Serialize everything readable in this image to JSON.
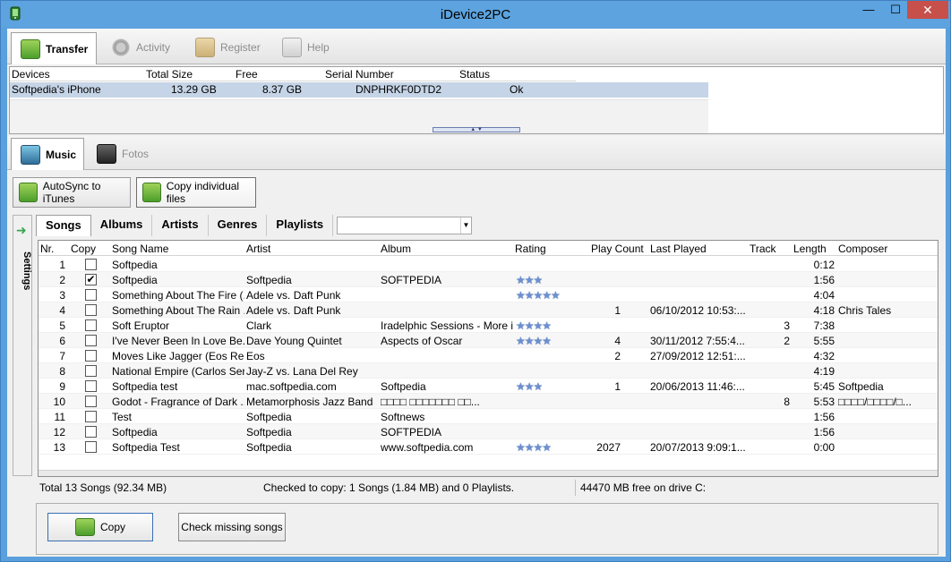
{
  "window": {
    "title": "iDevice2PC",
    "min": "—",
    "max": "☐",
    "close": "✕"
  },
  "toptabs": [
    {
      "label": "Transfer",
      "icon": "transfer-icon"
    },
    {
      "label": "Activity",
      "icon": "gear-icon"
    },
    {
      "label": "Register",
      "icon": "lock-icon"
    },
    {
      "label": "Help",
      "icon": "help-icon"
    }
  ],
  "devices": {
    "headers": [
      "Devices",
      "Total Size",
      "Free",
      "Serial Number",
      "Status"
    ],
    "row": [
      "Softpedia's iPhone",
      "13.29 GB",
      "8.37 GB",
      "DNPHRKF0DTD2",
      "Ok"
    ]
  },
  "subtabs": [
    {
      "label": "Music",
      "icon": "music-icon"
    },
    {
      "label": "Fotos",
      "icon": "camera-icon"
    }
  ],
  "mode": {
    "autosync": "AutoSync to iTunes",
    "copy_individual": "Copy individual files"
  },
  "settings_label": "Settings",
  "filters": [
    "Songs",
    "Albums",
    "Artists",
    "Genres",
    "Playlists"
  ],
  "columns": [
    "Nr.",
    "Copy",
    "Song Name",
    "Artist",
    "Album",
    "Rating",
    "Play Count",
    "Last Played",
    "Track",
    "Length",
    "Composer"
  ],
  "songs": [
    {
      "nr": "1",
      "checked": false,
      "name": "Softpedia",
      "artist": "",
      "album": "",
      "rating": 0,
      "plays": "",
      "last": "",
      "track": "",
      "length": "0:12",
      "composer": ""
    },
    {
      "nr": "2",
      "checked": true,
      "name": "Softpedia",
      "artist": "Softpedia",
      "album": "SOFTPEDIA",
      "rating": 3,
      "plays": "",
      "last": "",
      "track": "",
      "length": "1:56",
      "composer": ""
    },
    {
      "nr": "3",
      "checked": false,
      "name": "Something About The Fire (...",
      "artist": "Adele vs. Daft Punk",
      "album": "",
      "rating": 5,
      "plays": "",
      "last": "",
      "track": "",
      "length": "4:04",
      "composer": ""
    },
    {
      "nr": "4",
      "checked": false,
      "name": "Something About The Rain ...",
      "artist": "Adele vs. Daft Punk",
      "album": "",
      "rating": 0,
      "plays": "1",
      "last": "06/10/2012 10:53:...",
      "track": "",
      "length": "4:18",
      "composer": "Chris Tales"
    },
    {
      "nr": "5",
      "checked": false,
      "name": "Soft Eruptor",
      "artist": "Clark",
      "album": "Iradelphic Sessions - More i...",
      "rating": 4,
      "plays": "",
      "last": "",
      "track": "3",
      "length": "7:38",
      "composer": ""
    },
    {
      "nr": "6",
      "checked": false,
      "name": "I've Never Been In Love Be...",
      "artist": "Dave Young Quintet",
      "album": "Aspects of Oscar",
      "rating": 4,
      "plays": "4",
      "last": "30/11/2012 7:55:4...",
      "track": "2",
      "length": "5:55",
      "composer": ""
    },
    {
      "nr": "7",
      "checked": false,
      "name": "Moves Like Jagger (Eos Re...",
      "artist": "Eos",
      "album": "",
      "rating": 0,
      "plays": "2",
      "last": "27/09/2012 12:51:...",
      "track": "",
      "length": "4:32",
      "composer": ""
    },
    {
      "nr": "8",
      "checked": false,
      "name": "National Empire (Carlos Ser...",
      "artist": "Jay-Z vs. Lana Del Rey",
      "album": "",
      "rating": 0,
      "plays": "",
      "last": "",
      "track": "",
      "length": "4:19",
      "composer": ""
    },
    {
      "nr": "9",
      "checked": false,
      "name": "Softpedia test",
      "artist": "mac.softpedia.com",
      "album": "Softpedia",
      "rating": 3,
      "plays": "1",
      "last": "20/06/2013 11:46:...",
      "track": "",
      "length": "5:45",
      "composer": "Softpedia"
    },
    {
      "nr": "10",
      "checked": false,
      "name": "Godot - Fragrance of Dark ...",
      "artist": "Metamorphosis Jazz Band",
      "album": "□□□□ □□□□□□□ □□...",
      "rating": 0,
      "plays": "",
      "last": "",
      "track": "8",
      "length": "5:53",
      "composer": "□□□□/□□□□/□..."
    },
    {
      "nr": "11",
      "checked": false,
      "name": "Test",
      "artist": "Softpedia",
      "album": "Softnews",
      "rating": 0,
      "plays": "",
      "last": "",
      "track": "",
      "length": "1:56",
      "composer": ""
    },
    {
      "nr": "12",
      "checked": false,
      "name": "Softpedia",
      "artist": "Softpedia",
      "album": "SOFTPEDIA",
      "rating": 0,
      "plays": "",
      "last": "",
      "track": "",
      "length": "1:56",
      "composer": ""
    },
    {
      "nr": "13",
      "checked": false,
      "name": "Softpedia Test",
      "artist": "Softpedia",
      "album": "www.softpedia.com",
      "rating": 4,
      "plays": "2027",
      "last": "20/07/2013 9:09:1...",
      "track": "",
      "length": "0:00",
      "composer": ""
    }
  ],
  "status": {
    "total": "Total 13 Songs (92.34 MB)",
    "checked": "Checked to copy: 1 Songs (1.84 MB) and 0 Playlists.",
    "free": "44470 MB free on drive C:"
  },
  "buttons": {
    "copy": "Copy",
    "check_missing": "Check missing songs"
  },
  "colors": {
    "accent": "#5ca3df",
    "selection": "#c5d4e6",
    "close": "#c7504b",
    "star": "#6b8fd0"
  }
}
